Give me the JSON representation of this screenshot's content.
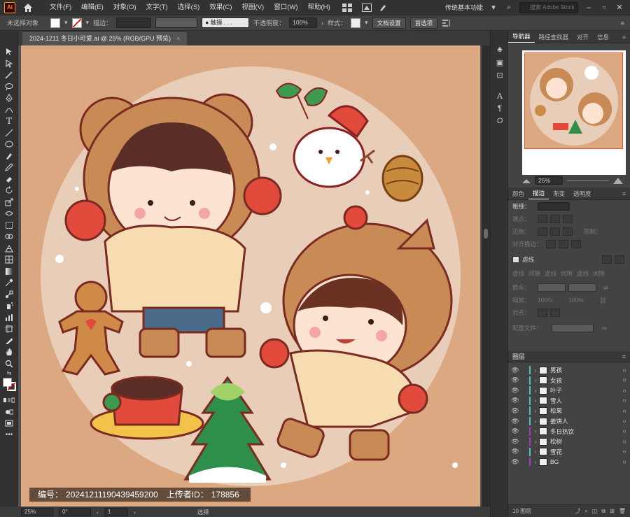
{
  "menubar": {
    "logo": "Ai",
    "items": [
      "文件(F)",
      "编辑(E)",
      "对象(O)",
      "文字(T)",
      "选择(S)",
      "效果(C)",
      "视图(V)",
      "窗口(W)",
      "帮助(H)"
    ],
    "workspace": "传统基本功能",
    "search_placeholder": "搜索 Adobe Stock"
  },
  "control_bar": {
    "no_selection": "未选择对象",
    "stroke_label": "描边：",
    "brush": "● 触摸 . . .",
    "opacity_label": "不透明度：",
    "opacity_value": "100%",
    "style_label": "样式：",
    "doc_setup": "文档设置",
    "preferences": "首选项"
  },
  "document": {
    "tab_title": "2024-1211 冬日小可爱.ai @ 25% (RGB/GPU 预览)",
    "close": "×",
    "caption_id_label": "编号：",
    "caption_id": "20241211190439459200",
    "caption_uploader_label": "上传者ID：",
    "caption_uploader": "178856"
  },
  "status_bar": {
    "zoom": "25%",
    "rotation": "0°",
    "artboard": "1",
    "mode": "选择"
  },
  "panels": {
    "top_tabs": [
      "导航器",
      "路径查找器",
      "对齐",
      "信息"
    ],
    "nav_zoom": "25%",
    "mid_tabs": [
      "颜色",
      "描边",
      "渐变",
      "透明度"
    ],
    "stroke": {
      "weight_label": "粗细：",
      "cap_label": "端点：",
      "corner_label": "边角：",
      "limit_label": "限制：",
      "align_label": "对齐描边：",
      "dashed_label": "虚线",
      "dash_labels": [
        "虚线",
        "间隙",
        "虚线",
        "间隙",
        "虚线",
        "间隙"
      ],
      "arrow_label": "箭头：",
      "scale_label": "缩放：",
      "scale_values": [
        "100%",
        "100%"
      ],
      "align_arrow_label": "对齐：",
      "profile_label": "配置文件："
    },
    "layers_title": "图层",
    "layers": [
      {
        "name": "男孩",
        "color": "#4fc3c3"
      },
      {
        "name": "女孩",
        "color": "#4fc3c3"
      },
      {
        "name": "叶子",
        "color": "#4fc3c3"
      },
      {
        "name": "雪人",
        "color": "#4fc3c3"
      },
      {
        "name": "松果",
        "color": "#4fc3c3"
      },
      {
        "name": "姜饼人",
        "color": "#4fc3c3"
      },
      {
        "name": "冬日热饮",
        "color": "#a040c0"
      },
      {
        "name": "松树",
        "color": "#a040c0"
      },
      {
        "name": "雪花",
        "color": "#4fc3c3"
      },
      {
        "name": "BG",
        "color": "#a040c0"
      }
    ],
    "layers_count": "10 图层"
  }
}
